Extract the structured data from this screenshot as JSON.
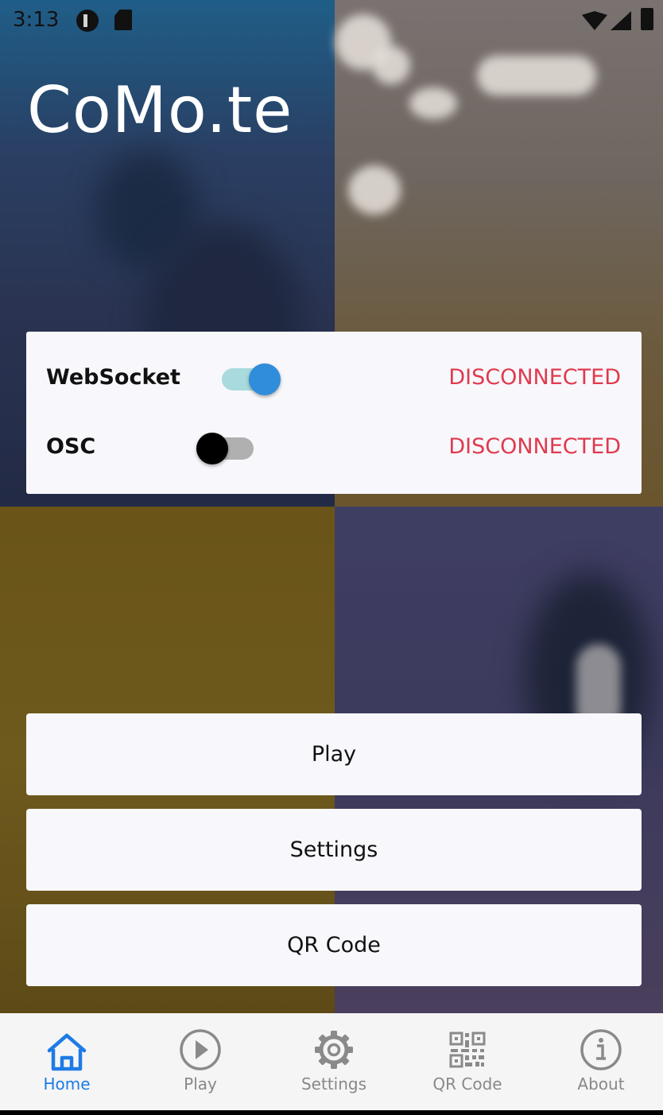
{
  "status_bar": {
    "time": "3:13"
  },
  "app": {
    "title": "CoMo.te"
  },
  "connections": [
    {
      "label": "WebSocket",
      "enabled": true,
      "status": "DISCONNECTED"
    },
    {
      "label": "OSC",
      "enabled": false,
      "status": "DISCONNECTED"
    }
  ],
  "buttons": {
    "play": "Play",
    "settings": "Settings",
    "qr": "QR Code"
  },
  "nav": {
    "home": "Home",
    "play": "Play",
    "settings": "Settings",
    "qr": "QR Code",
    "about": "About"
  },
  "colors": {
    "accent": "#1e7be6",
    "status_error": "#e03a4f",
    "switch_thumb_on": "#2f8ddb",
    "switch_track_on": "#a9dadd"
  },
  "icons": {
    "status": [
      "app-notification-icon",
      "sd-card-icon",
      "wifi-icon",
      "signal-icon",
      "battery-icon"
    ],
    "nav": [
      "home-icon",
      "play-circle-icon",
      "gear-icon",
      "qr-code-icon",
      "info-icon"
    ]
  }
}
